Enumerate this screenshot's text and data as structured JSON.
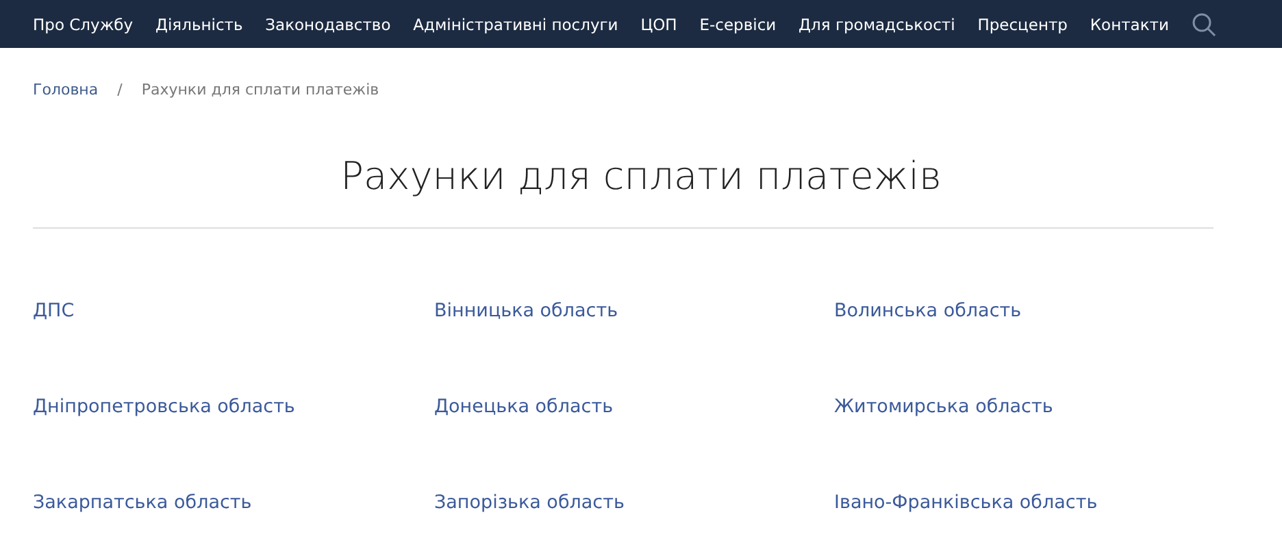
{
  "nav": {
    "items": [
      "Про Службу",
      "Діяльність",
      "Законодавство",
      "Адміністративні послуги",
      "ЦОП",
      "Е-сервіси",
      "Для громадськості",
      "Пресцентр",
      "Контакти"
    ]
  },
  "breadcrumb": {
    "items": [
      "Головна",
      "Рахунки для сплати платежів"
    ],
    "separator": "/"
  },
  "title": "Рахунки для сплати платежів",
  "links": [
    "ДПС",
    "Вінницька область",
    "Волинська область",
    "Дніпропетровська область",
    "Донецька область",
    "Житомирська область",
    "Закарпатська область",
    "Запорізька область",
    "Івано-Франківська область"
  ]
}
